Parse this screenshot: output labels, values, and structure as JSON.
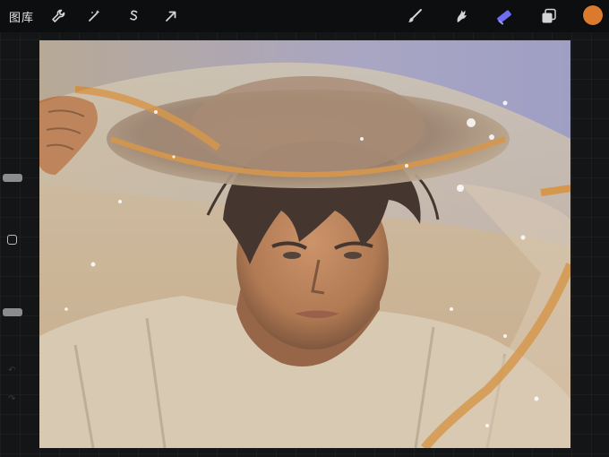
{
  "topbar": {
    "gallery_label": "图库",
    "left_tools": [
      {
        "name": "actions",
        "icon": "wrench-icon"
      },
      {
        "name": "adjustments",
        "icon": "magic-wand-icon"
      },
      {
        "name": "selection",
        "icon": "selection-s-icon"
      },
      {
        "name": "transform",
        "icon": "arrow-cursor-icon"
      }
    ],
    "right_tools": [
      {
        "name": "brush",
        "icon": "brush-icon"
      },
      {
        "name": "smudge",
        "icon": "smudge-icon"
      },
      {
        "name": "eraser",
        "icon": "eraser-icon",
        "active": true,
        "active_color": "#6d6df2"
      },
      {
        "name": "layers",
        "icon": "layers-icon"
      }
    ],
    "current_color": "#d97a2c"
  },
  "sidebar": {
    "size_slider": "brush-size-slider",
    "opacity_slider": "opacity-slider",
    "modify_button": "square-icon"
  },
  "canvas": {
    "artwork": "painting-of-person-under-translucent-veil-with-hat",
    "palette": {
      "sky": "#a9a6c3",
      "skin": "#b77a4f",
      "shirt": "#d6c6ae",
      "veil_orange": "#d38b37",
      "hair": "#2a1b15"
    }
  }
}
